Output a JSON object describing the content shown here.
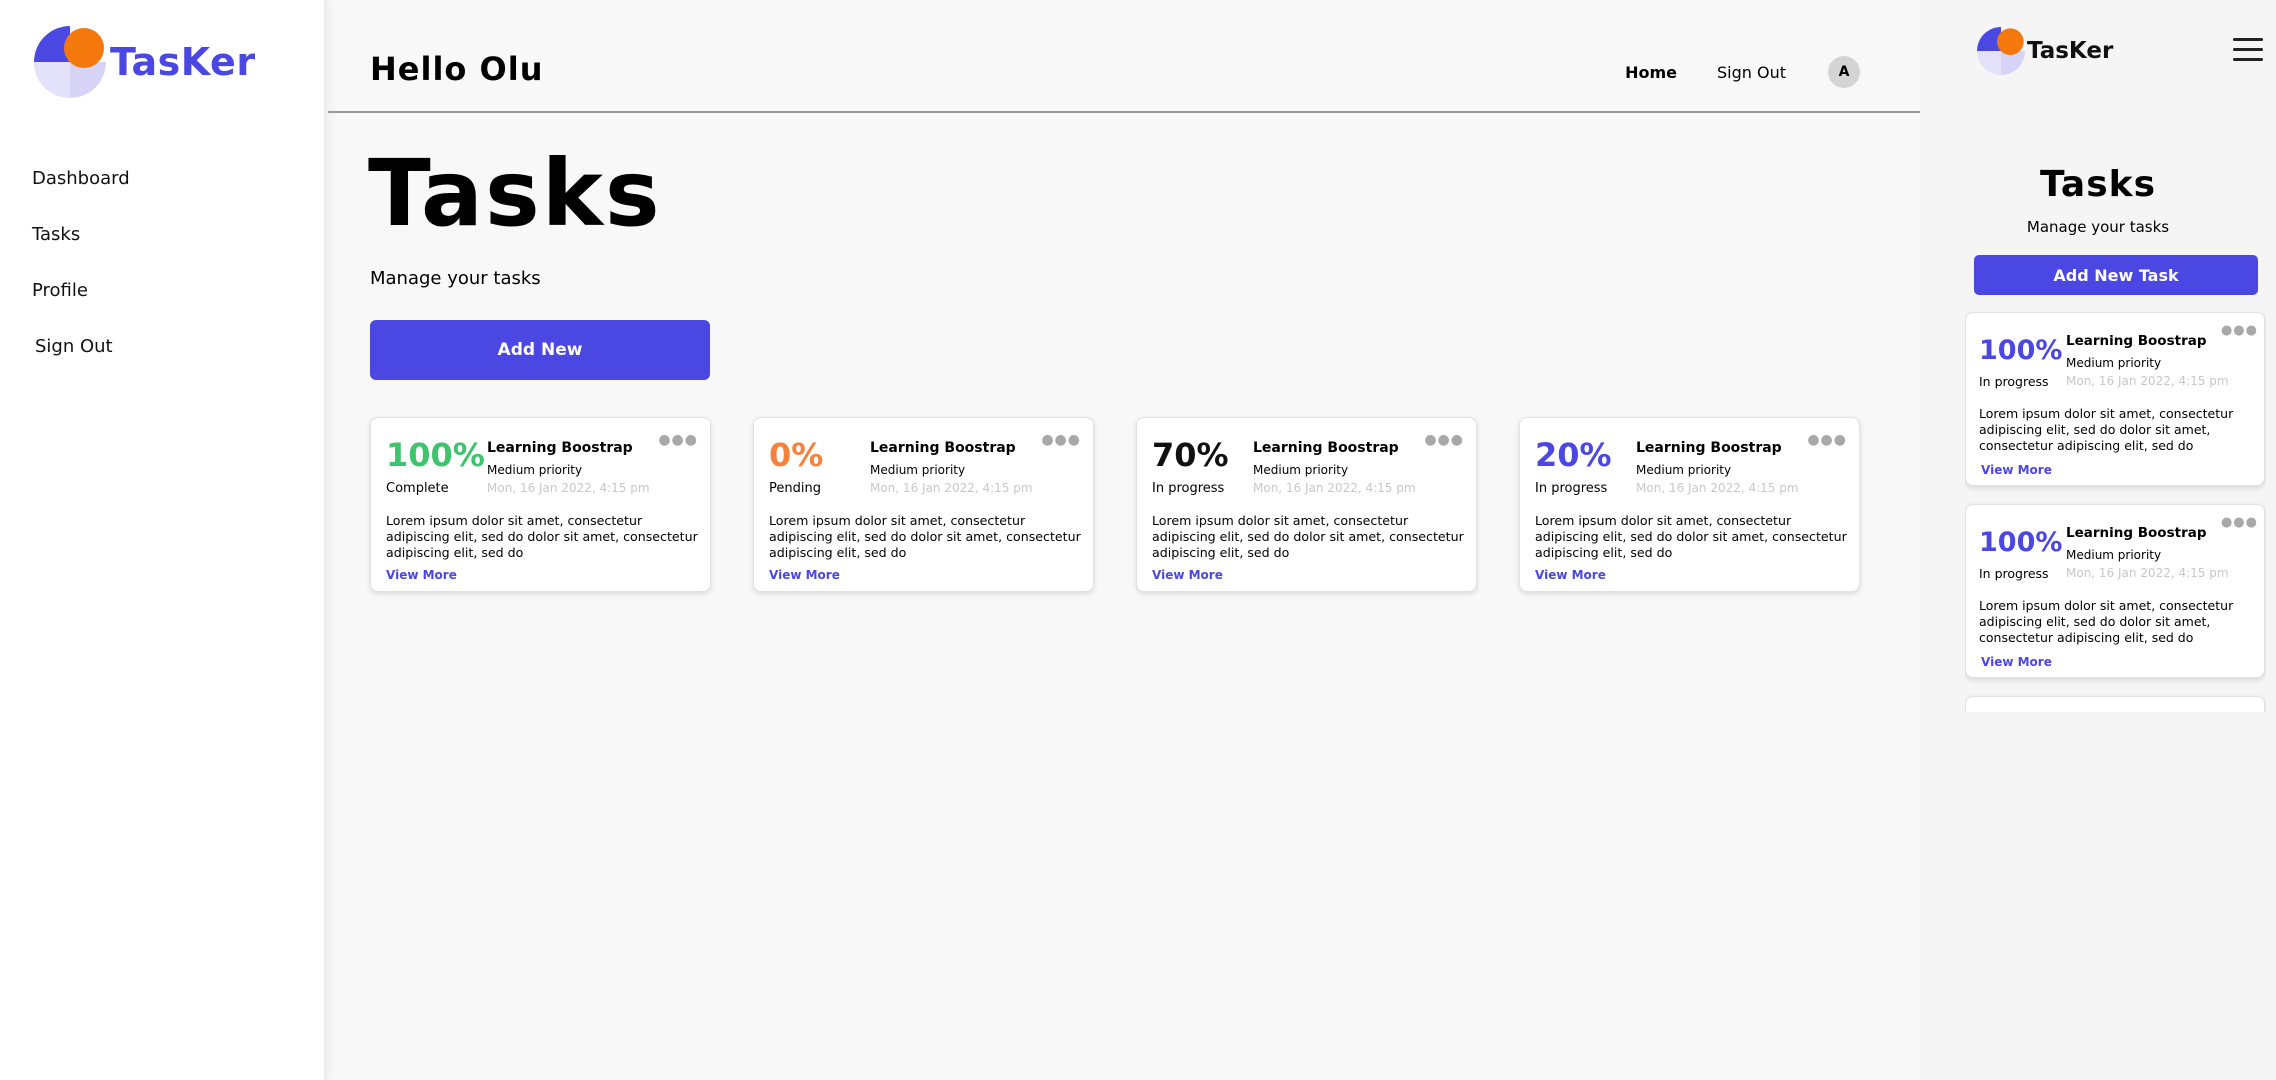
{
  "brand": {
    "name": "TasKer",
    "accent": "#4b47e3",
    "logo_orange": "#f5780d",
    "logo_light": "#d6d3f7"
  },
  "sidebar": {
    "items": [
      {
        "label": "Dashboard"
      },
      {
        "label": "Tasks"
      },
      {
        "label": "Profile"
      },
      {
        "label": "Sign Out"
      }
    ]
  },
  "header": {
    "greeting": "Hello Olu",
    "links": [
      {
        "label": "Home",
        "active": true
      },
      {
        "label": "Sign Out"
      }
    ],
    "avatar": "A"
  },
  "main": {
    "title": "Tasks",
    "subtitle": "Manage your tasks",
    "add_button": "Add New",
    "more_icon": "more-dots-icon",
    "cards": [
      {
        "percent": "100%",
        "percent_color": "#3ec46d",
        "status": "Complete",
        "title": "Learning Boostrap",
        "priority": "Medium priority",
        "date": "Mon, 16 Jan 2022, 4:15 pm",
        "description": "Lorem ipsum dolor sit amet, consectetur adipiscing elit, sed do  dolor sit amet, consectetur adipiscing elit, sed do",
        "link": "View More"
      },
      {
        "percent": "0%",
        "percent_color": "#f5813d",
        "status": "Pending",
        "title": "Learning Boostrap",
        "priority": "Medium priority",
        "date": "Mon, 16 Jan 2022, 4:15 pm",
        "description": "Lorem ipsum dolor sit amet, consectetur adipiscing elit, sed do  dolor sit amet, consectetur adipiscing elit, sed do",
        "link": "View More"
      },
      {
        "percent": "70%",
        "percent_color": "#111111",
        "status": "In progress",
        "title": "Learning Boostrap",
        "priority": "Medium priority",
        "date": "Mon, 16 Jan 2022, 4:15 pm",
        "description": "Lorem ipsum dolor sit amet, consectetur adipiscing elit, sed do  dolor sit amet, consectetur adipiscing elit, sed do",
        "link": "View More"
      },
      {
        "percent": "20%",
        "percent_color": "#4b47e3",
        "status": "In progress",
        "title": "Learning Boostrap",
        "priority": "Medium priority",
        "date": "Mon, 16 Jan 2022, 4:15 pm",
        "description": "Lorem ipsum dolor sit amet, consectetur adipiscing elit, sed do  dolor sit amet, consectetur adipiscing elit, sed do",
        "link": "View More"
      }
    ]
  },
  "mobile": {
    "brand": "TasKer",
    "menu_icon": "hamburger-menu-icon",
    "title": "Tasks",
    "subtitle": "Manage your tasks",
    "add_button": "Add New Task",
    "cards": [
      {
        "percent": "100%",
        "status": "In progress",
        "title": "Learning Boostrap",
        "priority": "Medium priority",
        "date": "Mon, 16 Jan 2022, 4:15 pm",
        "description": "Lorem ipsum dolor sit amet, consectetur adipiscing elit, sed do  dolor sit amet, consectetur adipiscing elit, sed do",
        "link": "View More"
      },
      {
        "percent": "100%",
        "status": "In progress",
        "title": "Learning Boostrap",
        "priority": "Medium priority",
        "date": "Mon, 16 Jan 2022, 4:15 pm",
        "description": "Lorem ipsum dolor sit amet, consectetur adipiscing elit, sed do  dolor sit amet, consectetur adipiscing elit, sed do",
        "link": "View More"
      },
      {
        "percent": "",
        "status": "",
        "title": "",
        "priority": "",
        "date": "",
        "description": "",
        "link": ""
      }
    ]
  }
}
